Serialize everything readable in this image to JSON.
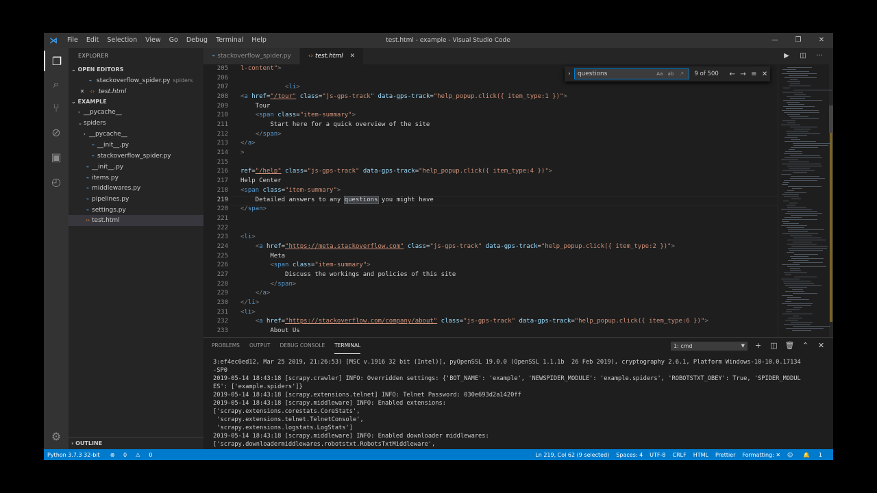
{
  "window": {
    "title": "test.html - example - Visual Studio Code",
    "menu": [
      "File",
      "Edit",
      "Selection",
      "View",
      "Go",
      "Debug",
      "Terminal",
      "Help"
    ]
  },
  "explorer": {
    "header": "EXPLORER",
    "open_editors_label": "OPEN EDITORS",
    "open_editors": [
      {
        "name": "stackoverflow_spider.py",
        "desc": "spiders",
        "icon": "python-file-icon"
      },
      {
        "name": "test.html",
        "icon": "html-file-icon"
      }
    ],
    "project_label": "EXAMPLE",
    "tree": [
      {
        "name": "__pycache__",
        "type": "folder",
        "depth": 1
      },
      {
        "name": "spiders",
        "type": "folder-open",
        "depth": 1
      },
      {
        "name": "__pycache__",
        "type": "folder",
        "depth": 2
      },
      {
        "name": "__init__.py",
        "type": "py",
        "depth": 2
      },
      {
        "name": "stackoverflow_spider.py",
        "type": "py",
        "depth": 2
      },
      {
        "name": "__init__.py",
        "type": "py",
        "depth": 1
      },
      {
        "name": "items.py",
        "type": "py",
        "depth": 1
      },
      {
        "name": "middlewares.py",
        "type": "py",
        "depth": 1
      },
      {
        "name": "pipelines.py",
        "type": "py",
        "depth": 1
      },
      {
        "name": "settings.py",
        "type": "py",
        "depth": 1
      },
      {
        "name": "test.html",
        "type": "html",
        "depth": 1
      }
    ],
    "outline_label": "OUTLINE"
  },
  "tabs": [
    {
      "label": "stackoverflow_spider.py",
      "active": false
    },
    {
      "label": "test.html",
      "active": true
    }
  ],
  "find": {
    "value": "questions",
    "count": "9 of 500"
  },
  "editor": {
    "current_line": 219,
    "lines": [
      {
        "n": "205",
        "parts": [
          [
            "t-str",
            "l-content\""
          ],
          [
            "t-gray",
            ">"
          ]
        ]
      },
      {
        "n": "206",
        "parts": []
      },
      {
        "n": "207",
        "parts": [
          [
            "t-txt",
            "            "
          ],
          [
            "t-gray",
            "<"
          ],
          [
            "t-tag",
            "li"
          ],
          [
            "t-gray",
            ">"
          ]
        ]
      },
      {
        "n": "208",
        "parts": [
          [
            "t-gray",
            "<"
          ],
          [
            "t-tag",
            "a "
          ],
          [
            "t-attr",
            "href"
          ],
          [
            "t-txt",
            "="
          ],
          [
            "t-str u",
            "\"/tour\""
          ],
          [
            "t-txt",
            " "
          ],
          [
            "t-attr",
            "class"
          ],
          [
            "t-txt",
            "="
          ],
          [
            "t-str",
            "\"js-gps-track\""
          ],
          [
            "t-txt",
            " "
          ],
          [
            "t-attr",
            "data-gps-track"
          ],
          [
            "t-txt",
            "="
          ],
          [
            "t-str",
            "\"help_popup.click({ item_type:1 })\""
          ],
          [
            "t-gray",
            ">"
          ]
        ]
      },
      {
        "n": "209",
        "parts": [
          [
            "t-txt",
            "    Tour"
          ]
        ]
      },
      {
        "n": "210",
        "parts": [
          [
            "t-txt",
            "    "
          ],
          [
            "t-gray",
            "<"
          ],
          [
            "t-tag",
            "span "
          ],
          [
            "t-attr",
            "class"
          ],
          [
            "t-txt",
            "="
          ],
          [
            "t-str",
            "\"item-summary\""
          ],
          [
            "t-gray",
            ">"
          ]
        ]
      },
      {
        "n": "211",
        "parts": [
          [
            "t-txt",
            "        Start here for a quick overview of the site"
          ]
        ]
      },
      {
        "n": "212",
        "parts": [
          [
            "t-txt",
            "    "
          ],
          [
            "t-gray",
            "</"
          ],
          [
            "t-tag",
            "span"
          ],
          [
            "t-gray",
            ">"
          ]
        ]
      },
      {
        "n": "213",
        "parts": [
          [
            "t-gray",
            "</"
          ],
          [
            "t-tag",
            "a"
          ],
          [
            "t-gray",
            ">"
          ]
        ]
      },
      {
        "n": "214",
        "parts": [
          [
            "t-gray",
            ">"
          ]
        ]
      },
      {
        "n": "215",
        "parts": []
      },
      {
        "n": "216",
        "parts": [
          [
            "t-attr",
            "ref"
          ],
          [
            "t-txt",
            "="
          ],
          [
            "t-str u",
            "\"/help\""
          ],
          [
            "t-txt",
            " "
          ],
          [
            "t-attr",
            "class"
          ],
          [
            "t-txt",
            "="
          ],
          [
            "t-str",
            "\"js-gps-track\""
          ],
          [
            "t-txt",
            " "
          ],
          [
            "t-attr",
            "data-gps-track"
          ],
          [
            "t-txt",
            "="
          ],
          [
            "t-str",
            "\"help_popup.click({ item_type:4 })\""
          ],
          [
            "t-gray",
            ">"
          ]
        ]
      },
      {
        "n": "217",
        "parts": [
          [
            "t-txt",
            "Help Center"
          ]
        ]
      },
      {
        "n": "218",
        "parts": [
          [
            "t-gray",
            "<"
          ],
          [
            "t-tag",
            "span "
          ],
          [
            "t-attr",
            "class"
          ],
          [
            "t-txt",
            "="
          ],
          [
            "t-str",
            "\"item-summary\""
          ],
          [
            "t-gray",
            ">"
          ]
        ]
      },
      {
        "n": "219",
        "parts": [
          [
            "t-txt",
            "    Detailed answers to any "
          ],
          [
            "t-txt hl",
            "questions"
          ],
          [
            "t-txt",
            " you might have"
          ]
        ]
      },
      {
        "n": "220",
        "parts": [
          [
            "t-gray",
            "</"
          ],
          [
            "t-tag",
            "span"
          ],
          [
            "t-gray",
            ">"
          ]
        ]
      },
      {
        "n": "221",
        "parts": []
      },
      {
        "n": "222",
        "parts": []
      },
      {
        "n": "223",
        "parts": [
          [
            "t-gray",
            "<"
          ],
          [
            "t-tag",
            "li"
          ],
          [
            "t-gray",
            ">"
          ]
        ]
      },
      {
        "n": "224",
        "parts": [
          [
            "t-txt",
            "    "
          ],
          [
            "t-gray",
            "<"
          ],
          [
            "t-tag",
            "a "
          ],
          [
            "t-attr",
            "href"
          ],
          [
            "t-txt",
            "="
          ],
          [
            "t-str u",
            "\"https://meta.stackoverflow.com\""
          ],
          [
            "t-txt",
            " "
          ],
          [
            "t-attr",
            "class"
          ],
          [
            "t-txt",
            "="
          ],
          [
            "t-str",
            "\"js-gps-track\""
          ],
          [
            "t-txt",
            " "
          ],
          [
            "t-attr",
            "data-gps-track"
          ],
          [
            "t-txt",
            "="
          ],
          [
            "t-str",
            "\"help_popup.click({ item_type:2 })\""
          ],
          [
            "t-gray",
            ">"
          ]
        ]
      },
      {
        "n": "225",
        "parts": [
          [
            "t-txt",
            "        Meta"
          ]
        ]
      },
      {
        "n": "226",
        "parts": [
          [
            "t-txt",
            "        "
          ],
          [
            "t-gray",
            "<"
          ],
          [
            "t-tag",
            "span "
          ],
          [
            "t-attr",
            "class"
          ],
          [
            "t-txt",
            "="
          ],
          [
            "t-str",
            "\"item-summary\""
          ],
          [
            "t-gray",
            ">"
          ]
        ]
      },
      {
        "n": "227",
        "parts": [
          [
            "t-txt",
            "            Discuss the workings and policies of this site"
          ]
        ]
      },
      {
        "n": "228",
        "parts": [
          [
            "t-txt",
            "        "
          ],
          [
            "t-gray",
            "</"
          ],
          [
            "t-tag",
            "span"
          ],
          [
            "t-gray",
            ">"
          ]
        ]
      },
      {
        "n": "229",
        "parts": [
          [
            "t-txt",
            "    "
          ],
          [
            "t-gray",
            "</"
          ],
          [
            "t-tag",
            "a"
          ],
          [
            "t-gray",
            ">"
          ]
        ]
      },
      {
        "n": "230",
        "parts": [
          [
            "t-gray",
            "</"
          ],
          [
            "t-tag",
            "li"
          ],
          [
            "t-gray",
            ">"
          ]
        ]
      },
      {
        "n": "231",
        "parts": [
          [
            "t-gray",
            "<"
          ],
          [
            "t-tag",
            "li"
          ],
          [
            "t-gray",
            ">"
          ]
        ]
      },
      {
        "n": "232",
        "parts": [
          [
            "t-txt",
            "    "
          ],
          [
            "t-gray",
            "<"
          ],
          [
            "t-tag",
            "a "
          ],
          [
            "t-attr",
            "href"
          ],
          [
            "t-txt",
            "="
          ],
          [
            "t-str u",
            "\"https://stackoverflow.com/company/about\""
          ],
          [
            "t-txt",
            " "
          ],
          [
            "t-attr",
            "class"
          ],
          [
            "t-txt",
            "="
          ],
          [
            "t-str",
            "\"js-gps-track\""
          ],
          [
            "t-txt",
            " "
          ],
          [
            "t-attr",
            "data-gps-track"
          ],
          [
            "t-txt",
            "="
          ],
          [
            "t-str",
            "\"help_popup.click({ item_type:6 })\""
          ],
          [
            "t-gray",
            ">"
          ]
        ]
      },
      {
        "n": "233",
        "parts": [
          [
            "t-txt",
            "        About Us"
          ]
        ]
      }
    ]
  },
  "panel": {
    "tabs": [
      "PROBLEMS",
      "OUTPUT",
      "DEBUG CONSOLE",
      "TERMINAL"
    ],
    "active_tab": "TERMINAL",
    "terminal_select": "1: cmd",
    "terminal_lines": [
      "3:ef4ec6ed12, Mar 25 2019, 21:26:53) [MSC v.1916 32 bit (Intel)], pyOpenSSL 19.0.0 (OpenSSL 1.1.1b  26 Feb 2019), cryptography 2.6.1, Platform Windows-10-10.0.17134",
      "-SP0",
      "2019-05-14 18:43:18 [scrapy.crawler] INFO: Overridden settings: {'BOT_NAME': 'example', 'NEWSPIDER_MODULE': 'example.spiders', 'ROBOTSTXT_OBEY': True, 'SPIDER_MODUL",
      "ES': ['example.spiders']}",
      "2019-05-14 18:43:18 [scrapy.extensions.telnet] INFO: Telnet Password: 030e693d2a1420ff",
      "2019-05-14 18:43:18 [scrapy.middleware] INFO: Enabled extensions:",
      "['scrapy.extensions.corestats.CoreStats',",
      " 'scrapy.extensions.telnet.TelnetConsole',",
      " 'scrapy.extensions.logstats.LogStats']",
      "2019-05-14 18:43:18 [scrapy.middleware] INFO: Enabled downloader middlewares:",
      "['scrapy.downloadermiddlewares.robotstxt.RobotsTxtMiddleware',"
    ]
  },
  "status": {
    "python": "Python 3.7.3 32-bit",
    "errors": "0",
    "warnings": "0",
    "position": "Ln 219, Col 62 (9 selected)",
    "spaces": "Spaces: 4",
    "encoding": "UTF-8",
    "eol": "CRLF",
    "language": "HTML",
    "prettier": "Prettier",
    "formatting": "Formatting: ✕",
    "notifications": "1"
  }
}
